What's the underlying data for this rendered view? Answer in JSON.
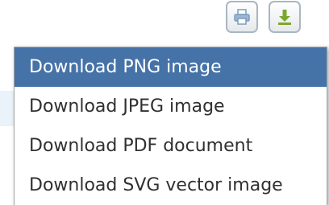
{
  "toolbar": {
    "print_icon": "printer-icon",
    "download_icon": "download-arrow-icon"
  },
  "menu": {
    "items": [
      {
        "label": "Download PNG image",
        "highlighted": true
      },
      {
        "label": "Download JPEG image",
        "highlighted": false
      },
      {
        "label": "Download PDF document",
        "highlighted": false
      },
      {
        "label": "Download SVG vector image",
        "highlighted": false
      }
    ]
  },
  "colors": {
    "highlight": "#4572a7",
    "menu_text": "#303030",
    "highlight_text": "#ffffff",
    "download_arrow": "#7ba82c",
    "print_icon": "#7d9cbe"
  }
}
